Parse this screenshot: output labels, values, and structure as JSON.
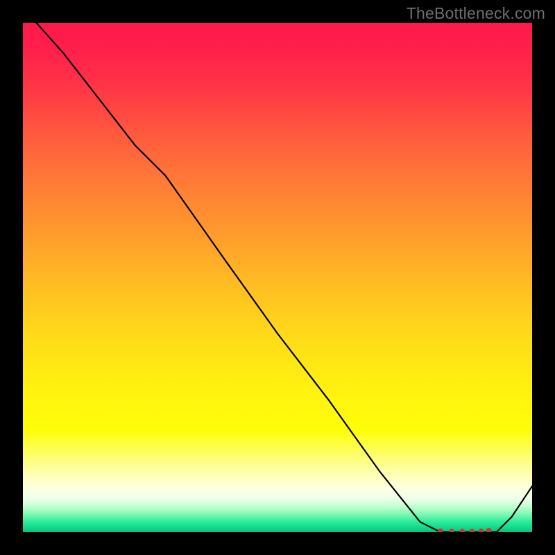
{
  "watermark": "TheBottleneck.com",
  "chart_data": {
    "type": "line",
    "title": "",
    "xlabel": "",
    "ylabel": "",
    "xlim": [
      0,
      100
    ],
    "ylim": [
      0,
      100
    ],
    "series": [
      {
        "name": "curve",
        "x": [
          0,
          8,
          15,
          22,
          28,
          40,
          50,
          60,
          70,
          78,
          82,
          85,
          87,
          89,
          91,
          93,
          96,
          100
        ],
        "values": [
          103,
          94,
          85,
          76,
          70,
          53,
          39,
          26,
          12,
          2,
          0,
          0,
          0,
          0,
          0,
          0,
          3,
          9
        ]
      }
    ],
    "markers": {
      "name": "highlight-dots",
      "x": [
        82,
        84.2,
        86.3,
        88.2,
        90.0,
        91.5
      ],
      "y": [
        0.2,
        0.1,
        0.1,
        0.1,
        0.15,
        0.3
      ]
    },
    "colors": {
      "curve": "#000000",
      "markers": "#c63a34",
      "gradient_top": "#ff184c",
      "gradient_bottom": "#0cc07b"
    }
  }
}
